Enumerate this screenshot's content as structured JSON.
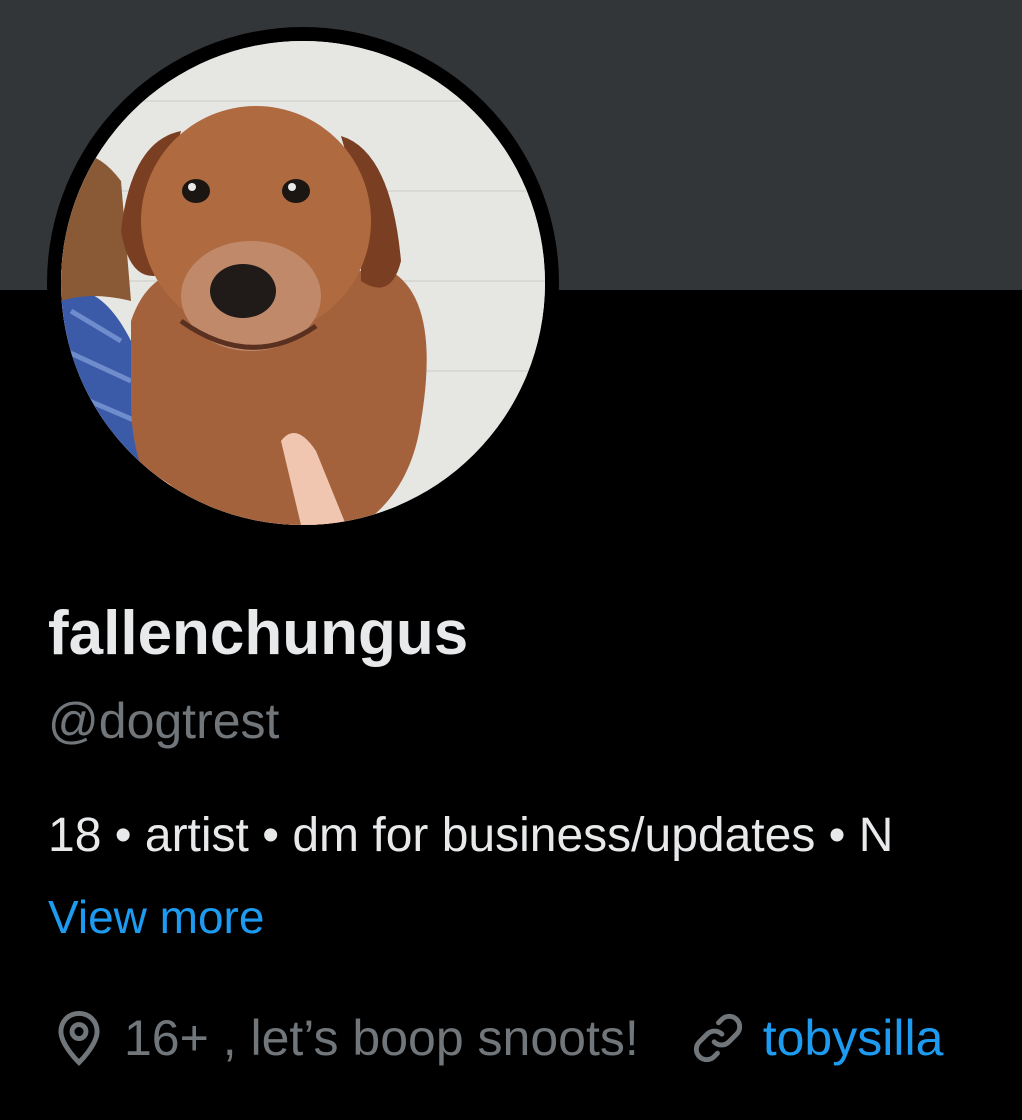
{
  "profile": {
    "display_name": "fallenchungus",
    "handle": "@dogtrest",
    "bio": "18 • artist • dm for business/updates • N",
    "view_more_label": "View more",
    "location": "16+ , let’s boop snoots!",
    "link": "tobysilla"
  },
  "icons": {
    "location": "location-pin-icon",
    "link": "link-icon"
  },
  "colors": {
    "background": "#000000",
    "banner": "#333639",
    "primary_text": "#e7e9ea",
    "secondary_text": "#71767b",
    "accent": "#1d9bf0"
  }
}
